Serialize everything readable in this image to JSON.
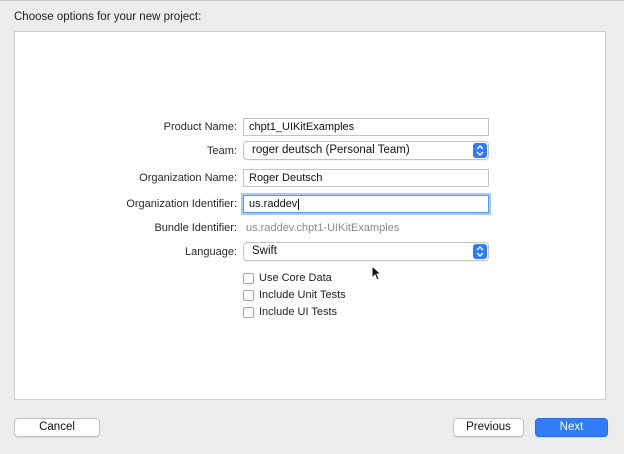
{
  "header": {
    "title": "Choose options for your new project:"
  },
  "form": {
    "product_name": {
      "label": "Product Name:",
      "value": "chpt1_UIKitExamples"
    },
    "team": {
      "label": "Team:",
      "value": "roger deutsch (Personal Team)"
    },
    "organization_name": {
      "label": "Organization Name:",
      "value": "Roger Deutsch"
    },
    "organization_identifier": {
      "label": "Organization Identifier:",
      "value": "us.raddev"
    },
    "bundle_identifier": {
      "label": "Bundle Identifier:",
      "value": "us.raddev.chpt1-UIKitExamples"
    },
    "language": {
      "label": "Language:",
      "value": "Swift"
    },
    "checkboxes": [
      {
        "label": "Use Core Data",
        "checked": false
      },
      {
        "label": "Include Unit Tests",
        "checked": false
      },
      {
        "label": "Include UI Tests",
        "checked": false
      }
    ]
  },
  "footer": {
    "cancel_label": "Cancel",
    "previous_label": "Previous",
    "next_label": "Next"
  },
  "colors": {
    "accent": "#2f7cf6",
    "focus_ring": "#a9caf7"
  },
  "icons": {
    "popup_arrow": "chevron-up-down-icon",
    "pointer": "mouse-pointer-icon"
  }
}
